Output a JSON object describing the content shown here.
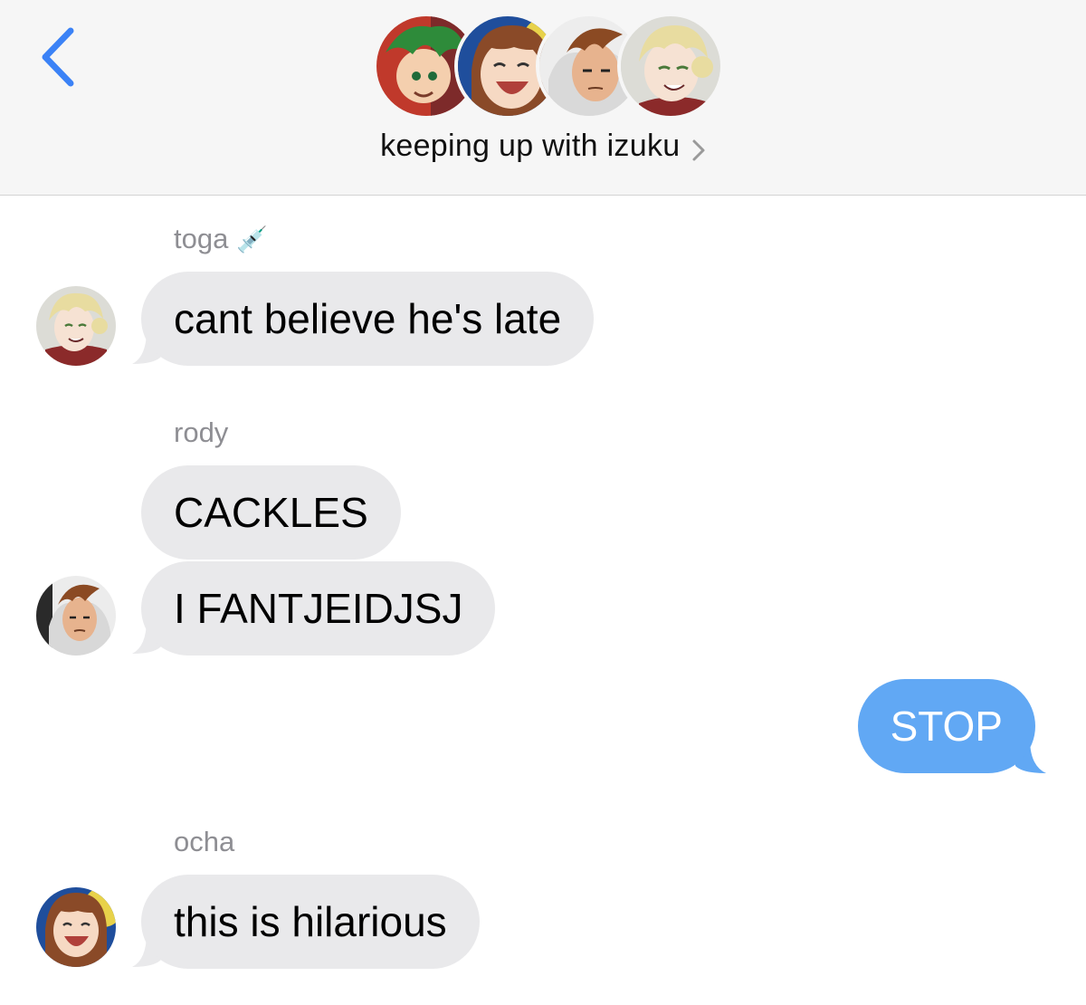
{
  "header": {
    "group_name": "keeping up with izuku",
    "members": [
      "izuku",
      "ocha",
      "rody",
      "toga"
    ]
  },
  "messages": [
    {
      "sender": "toga",
      "sender_emoji": "💉",
      "text": "cant believe he's late",
      "direction": "incoming"
    },
    {
      "sender": "rody",
      "text": "CACKLES",
      "direction": "incoming"
    },
    {
      "text": "I FANTJEIDJSJ",
      "direction": "incoming"
    },
    {
      "text": "STOP",
      "direction": "outgoing"
    },
    {
      "sender": "ocha",
      "text": "this is hilarious",
      "direction": "incoming"
    }
  ],
  "colors": {
    "incoming_bubble": "#e9e9eb",
    "outgoing_bubble": "#61a8f4",
    "accent": "#3b82f6"
  }
}
